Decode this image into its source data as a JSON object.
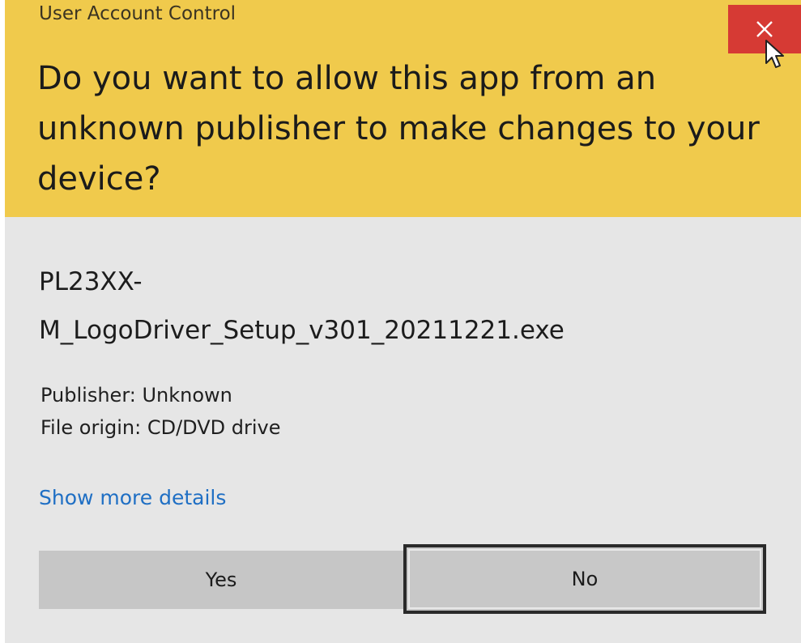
{
  "window": {
    "title": "User Account Control"
  },
  "header": {
    "question": "Do you want to allow this app from an unknown publisher to make changes to your device?",
    "close_icon": "close-icon",
    "header_color": "#f0ca4c",
    "close_color": "#d63a34"
  },
  "program": {
    "name_line1": "PL23XX-",
    "name_line2": "M_LogoDriver_Setup_v301_20211221.exe"
  },
  "info": {
    "publisher": "Publisher: Unknown",
    "file_origin": "File origin: CD/DVD drive"
  },
  "details_link": "Show more details",
  "link_color": "#1f6fc4",
  "buttons": {
    "yes": "Yes",
    "no": "No"
  }
}
